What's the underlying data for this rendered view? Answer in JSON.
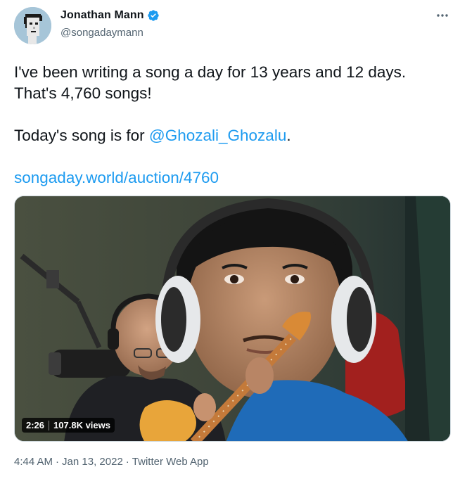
{
  "author": {
    "display_name": "Jonathan Mann",
    "handle": "@songadaymann",
    "verified_icon": "verified-badge-icon",
    "avatar_icon": "punk-avatar"
  },
  "tweet": {
    "line1": "I've been writing a song a day for 13 years and 12 days.",
    "line2": "That's 4,760 songs!",
    "line3_prefix": "Today's song is for ",
    "mention": "@Ghozali_Ghozalu",
    "line3_suffix": ".",
    "url": "songaday.world/auction/4760"
  },
  "media": {
    "type": "video",
    "duration": "2:26",
    "views": "107.8K views"
  },
  "meta": {
    "time": "4:44 AM",
    "date": "Jan 13, 2022",
    "source": "Twitter Web App",
    "separator": "·"
  },
  "colors": {
    "link": "#1d9bf0",
    "text": "#0f1419",
    "secondary": "#536471"
  }
}
